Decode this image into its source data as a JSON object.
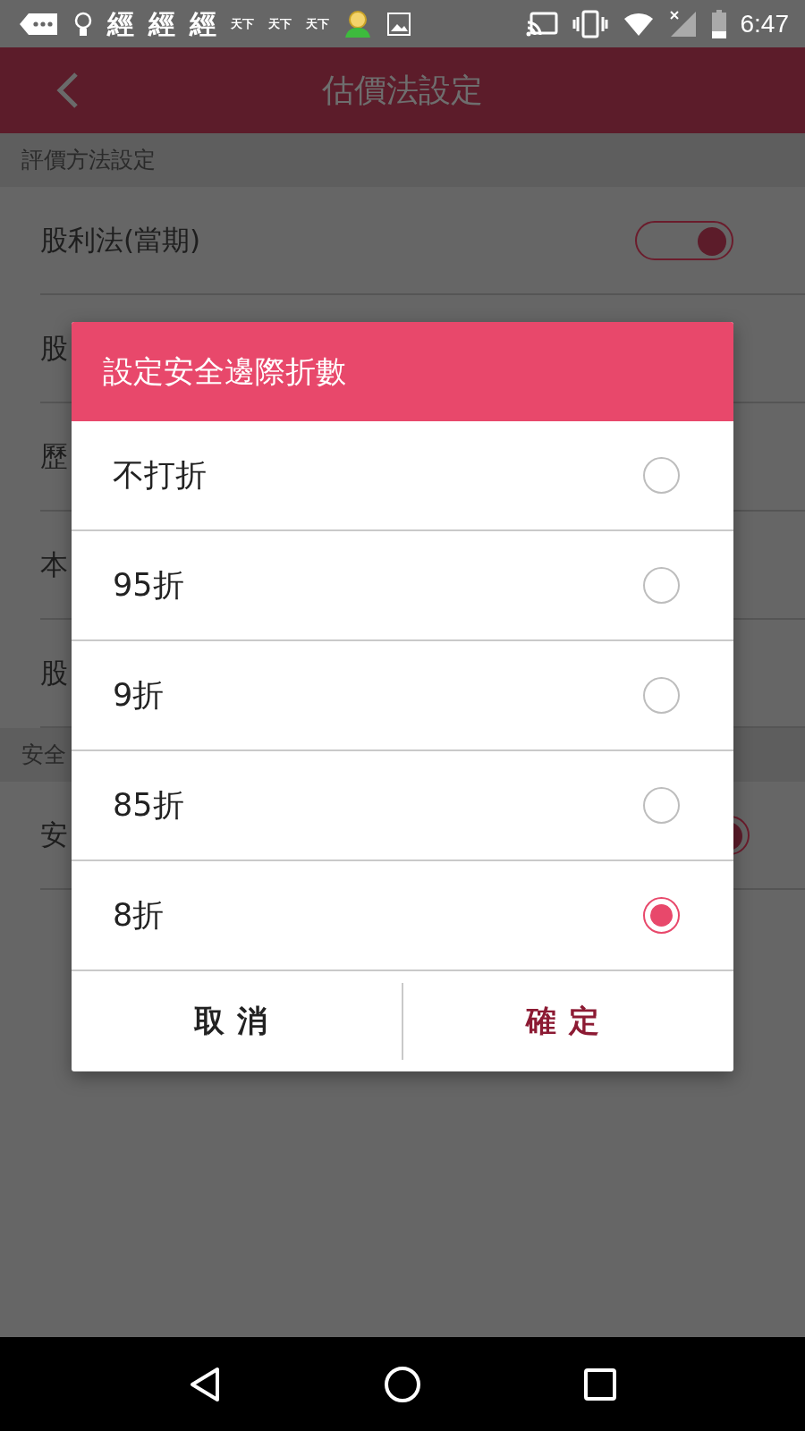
{
  "status_bar": {
    "notifications": [
      {
        "kind": "message"
      },
      {
        "kind": "bulb"
      },
      {
        "kind": "text",
        "label": "經"
      },
      {
        "kind": "text",
        "label": "經"
      },
      {
        "kind": "text",
        "label": "經"
      },
      {
        "kind": "small_text",
        "label": "天下"
      },
      {
        "kind": "small_text",
        "label": "天下"
      },
      {
        "kind": "small_text",
        "label": "天下"
      },
      {
        "kind": "person"
      },
      {
        "kind": "image"
      }
    ],
    "time": "6:47"
  },
  "app_bar": {
    "title": "估價法設定"
  },
  "sections": [
    {
      "header": "評價方法設定",
      "rows": [
        {
          "label": "股利法(當期)",
          "toggle_on": true
        },
        {
          "label": "股"
        },
        {
          "label": "歷"
        },
        {
          "label": "本"
        },
        {
          "label": "股"
        }
      ]
    },
    {
      "header": "安全",
      "rows": [
        {
          "label": "安",
          "toggle_on": true
        }
      ]
    }
  ],
  "dialog": {
    "title": "設定安全邊際折數",
    "options": [
      {
        "label": "不打折",
        "selected": false
      },
      {
        "label": "95折",
        "selected": false
      },
      {
        "label": "9折",
        "selected": false
      },
      {
        "label": "85折",
        "selected": false
      },
      {
        "label": "8折",
        "selected": true
      }
    ],
    "buttons": [
      {
        "label": "取消",
        "kind": "cancel"
      },
      {
        "label": "確定",
        "kind": "confirm"
      }
    ]
  }
}
